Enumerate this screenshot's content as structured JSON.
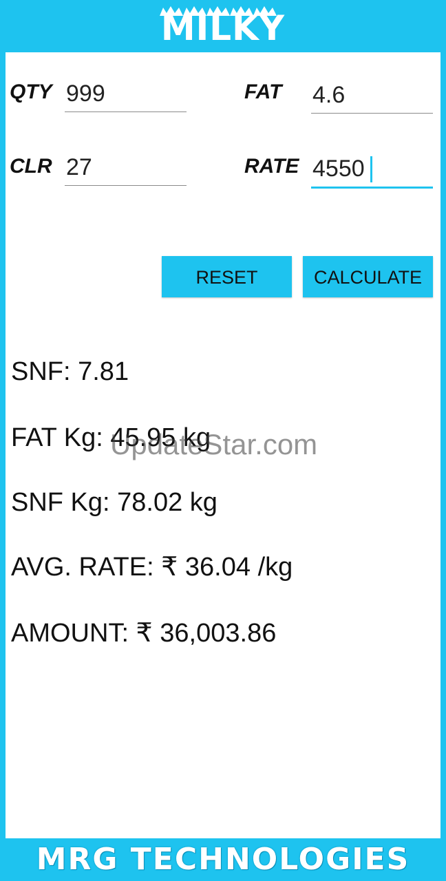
{
  "app": {
    "logo_text": "MILKY",
    "footer_text": "MRG TECHNOLOGIES"
  },
  "form": {
    "qty": {
      "label": "QTY",
      "value": "999"
    },
    "fat": {
      "label": "FAT",
      "value": "4.6"
    },
    "clr": {
      "label": "CLR",
      "value": "27"
    },
    "rate": {
      "label": "RATE",
      "value": "4550"
    }
  },
  "buttons": {
    "reset_label": "RESET",
    "calculate_label": "CALCULATE"
  },
  "results": {
    "snf": "SNF:  7.81",
    "fat_kg": "FAT Kg:  45.95 kg",
    "snf_kg": "SNF Kg:  78.02 kg",
    "avg_rate": "AVG. RATE:  ₹  36.04 /kg",
    "amount": "AMOUNT:  ₹  36,003.86"
  },
  "watermark": "UpdateStar.com",
  "colors": {
    "accent": "#1ec3ef",
    "card": "#ffffff"
  }
}
